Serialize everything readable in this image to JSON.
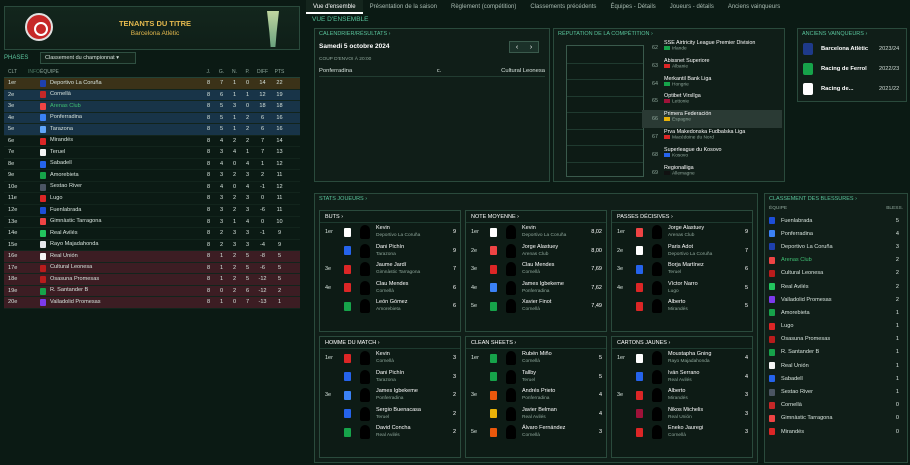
{
  "header": {
    "title": "TENANTS DU TITRE",
    "subtitle": "Barcelona Atlètic"
  },
  "phases": {
    "label": "PHASES",
    "selected": "Classement du championnat"
  },
  "league_table": {
    "columns": [
      "CLT",
      "INFO",
      "ÉQUIPE",
      "J.",
      "G.",
      "N.",
      "P.",
      "DIFF",
      "PTS"
    ],
    "rows": [
      {
        "pos": "1er",
        "club": "Deportivo La Coruña",
        "j": "8",
        "g": "7",
        "n": "1",
        "p": "0",
        "diff": "14",
        "pts": "22",
        "color": "#1e40af"
      },
      {
        "pos": "2e",
        "club": "Cornellà",
        "j": "8",
        "g": "6",
        "n": "1",
        "p": "1",
        "diff": "12",
        "pts": "19",
        "color": "#c62828"
      },
      {
        "pos": "3e",
        "club": "Arenas Club",
        "j": "8",
        "g": "5",
        "n": "3",
        "p": "0",
        "diff": "18",
        "pts": "18",
        "color": "#ef4444",
        "hl": true
      },
      {
        "pos": "4e",
        "club": "Ponferradina",
        "j": "8",
        "g": "5",
        "n": "1",
        "p": "2",
        "diff": "6",
        "pts": "16",
        "color": "#3b82f6"
      },
      {
        "pos": "5e",
        "club": "Tarazona",
        "j": "8",
        "g": "5",
        "n": "1",
        "p": "2",
        "diff": "6",
        "pts": "16",
        "color": "#60a5fa"
      },
      {
        "pos": "6e",
        "club": "Mirandés",
        "j": "8",
        "g": "4",
        "n": "2",
        "p": "2",
        "diff": "7",
        "pts": "14",
        "color": "#dc2626"
      },
      {
        "pos": "7e",
        "club": "Teruel",
        "j": "8",
        "g": "3",
        "n": "4",
        "p": "1",
        "diff": "7",
        "pts": "13",
        "color": "#f5f5f5"
      },
      {
        "pos": "8e",
        "club": "Sabadell",
        "j": "8",
        "g": "4",
        "n": "0",
        "p": "4",
        "diff": "1",
        "pts": "12",
        "color": "#2563eb"
      },
      {
        "pos": "9e",
        "club": "Amorebieta",
        "j": "8",
        "g": "3",
        "n": "2",
        "p": "3",
        "diff": "2",
        "pts": "11",
        "color": "#16a34a"
      },
      {
        "pos": "10e",
        "club": "Sestao River",
        "j": "8",
        "g": "4",
        "n": "0",
        "p": "4",
        "diff": "-1",
        "pts": "12",
        "color": "#4b5563"
      },
      {
        "pos": "11e",
        "club": "Lugo",
        "j": "8",
        "g": "3",
        "n": "2",
        "p": "3",
        "diff": "0",
        "pts": "11",
        "color": "#dc2626"
      },
      {
        "pos": "12e",
        "club": "Fuenlabrada",
        "j": "8",
        "g": "3",
        "n": "2",
        "p": "3",
        "diff": "-6",
        "pts": "11",
        "color": "#1d4ed8"
      },
      {
        "pos": "13e",
        "club": "Gimnàstic Tarragona",
        "j": "8",
        "g": "3",
        "n": "1",
        "p": "4",
        "diff": "0",
        "pts": "10",
        "color": "#ef4444"
      },
      {
        "pos": "14e",
        "club": "Real Avilés",
        "j": "8",
        "g": "2",
        "n": "3",
        "p": "3",
        "diff": "-1",
        "pts": "9",
        "color": "#22c55e"
      },
      {
        "pos": "15e",
        "club": "Rayo Majadahonda",
        "j": "8",
        "g": "2",
        "n": "3",
        "p": "3",
        "diff": "-4",
        "pts": "9",
        "color": "#e5e7eb"
      },
      {
        "pos": "16e",
        "club": "Real Unión",
        "j": "8",
        "g": "1",
        "n": "2",
        "p": "5",
        "diff": "-8",
        "pts": "5",
        "color": "#f5f5f5"
      },
      {
        "pos": "17e",
        "club": "Cultural Leonesa",
        "j": "8",
        "g": "1",
        "n": "2",
        "p": "5",
        "diff": "-6",
        "pts": "5",
        "color": "#b91c1c"
      },
      {
        "pos": "18e",
        "club": "Osasuna Promesas",
        "j": "8",
        "g": "1",
        "n": "2",
        "p": "5",
        "diff": "-12",
        "pts": "5",
        "color": "#b91c1c"
      },
      {
        "pos": "19e",
        "club": "R. Santander B",
        "j": "8",
        "g": "0",
        "n": "2",
        "p": "6",
        "diff": "-12",
        "pts": "2",
        "color": "#16a34a"
      },
      {
        "pos": "20e",
        "club": "Valladolid Promesas",
        "j": "8",
        "g": "1",
        "n": "0",
        "p": "7",
        "diff": "-13",
        "pts": "1",
        "color": "#7c3aed"
      }
    ]
  },
  "tabs": [
    "Vue d'ensemble",
    "Présentation de la saison",
    "Règlement (compétition)",
    "Classements précédents",
    "Équipes - Détails",
    "Joueurs - détails",
    "Anciens vainqueurs"
  ],
  "overview_label": "VUE D'ENSEMBLE",
  "calendar": {
    "title": "CALENDRIER/RÉSULTATS",
    "date": "Samedi 5 octobre 2024",
    "prev": "‹",
    "next": "›",
    "kickoff": "COUP D'ENVOI À 20:00",
    "home": "Ponferradina",
    "mid": "c.",
    "away": "Cultural Leonesa"
  },
  "reputation": {
    "title": "RÉPUTATION DE LA COMPÉTITION",
    "rows": [
      {
        "n": "62",
        "league": "SSE Airtricity League Premier Division",
        "country": "Irlande",
        "flag": "#16a34a"
      },
      {
        "n": "63",
        "league": "Abissnet Superiore",
        "country": "Albanie",
        "flag": "#dc2626"
      },
      {
        "n": "64",
        "league": "Merkantil Bank Liga",
        "country": "Hongrie",
        "flag": "#16a34a"
      },
      {
        "n": "65",
        "league": "Optibet Virslīga",
        "country": "Lettonie",
        "flag": "#9f1239"
      },
      {
        "n": "66",
        "league": "Primera Federación",
        "country": "Espagne",
        "flag": "#eab308",
        "sel": true
      },
      {
        "n": "67",
        "league": "Prva Makedonska Fudbalska Liga",
        "country": "Macédoine du Nord",
        "flag": "#dc2626"
      },
      {
        "n": "68",
        "league": "Superleague du Kosovo",
        "country": "Kosovo",
        "flag": "#2563eb"
      },
      {
        "n": "69",
        "league": "Regionalliga",
        "country": "Allemagne",
        "flag": "#111111"
      }
    ]
  },
  "winners": {
    "title": "ANCIENS VAINQUEURS",
    "rows": [
      {
        "club": "Barcelona Atlètic",
        "year": "2023/24",
        "color": "#1e3a8a"
      },
      {
        "club": "Racing de Ferrol",
        "year": "2022/23",
        "color": "#16a34a"
      },
      {
        "club": "Racing de...",
        "year": "2021/22",
        "color": "#ffffff"
      }
    ]
  },
  "stats": {
    "title": "STATS JOUEURS",
    "boxes": [
      {
        "title": "BUTS",
        "rows": [
          {
            "rk": "1er",
            "player": "Kevin",
            "club": "Deportivo La Coruña",
            "val": "9",
            "shirt": "#ffffff"
          },
          {
            "rk": "",
            "player": "Dani Pichín",
            "club": "Tarazona",
            "val": "9",
            "shirt": "#2563eb"
          },
          {
            "rk": "3e",
            "player": "Jaume Jardí",
            "club": "Gimnàstic Tarragona",
            "val": "7",
            "shirt": "#dc2626"
          },
          {
            "rk": "4e",
            "player": "Clau Mendes",
            "club": "Cornellà",
            "val": "6",
            "shirt": "#dc2626"
          },
          {
            "rk": "",
            "player": "León Gómez",
            "club": "Amorebieta",
            "val": "6",
            "shirt": "#16a34a"
          }
        ]
      },
      {
        "title": "NOTE MOYENNE",
        "rows": [
          {
            "rk": "1er",
            "player": "Kevin",
            "club": "Deportivo La Coruña",
            "val": "8,02",
            "shirt": "#ffffff"
          },
          {
            "rk": "2e",
            "player": "Jorge Alastuey",
            "club": "Arenas Club",
            "val": "8,00",
            "shirt": "#ef4444"
          },
          {
            "rk": "3e",
            "player": "Clau Mendes",
            "club": "Cornellà",
            "val": "7,69",
            "shirt": "#dc2626"
          },
          {
            "rk": "4e",
            "player": "James Igbekeme",
            "club": "Ponferradina",
            "val": "7,62",
            "shirt": "#3b82f6"
          },
          {
            "rk": "5e",
            "player": "Xavier Finot",
            "club": "Cornellà",
            "val": "7,49",
            "shirt": "#16a34a"
          }
        ]
      },
      {
        "title": "PASSES DÉCISIVES",
        "rows": [
          {
            "rk": "1er",
            "player": "Jorge Alastuey",
            "club": "Arenas Club",
            "val": "9",
            "shirt": "#ef4444"
          },
          {
            "rk": "2e",
            "player": "Paris Adot",
            "club": "Deportivo La Coruña",
            "val": "7",
            "shirt": "#ffffff"
          },
          {
            "rk": "3e",
            "player": "Borja Martínez",
            "club": "Teruel",
            "val": "6",
            "shirt": "#2563eb"
          },
          {
            "rk": "4e",
            "player": "Víctor Narro",
            "club": "Lugo",
            "val": "5",
            "shirt": "#dc2626"
          },
          {
            "rk": "",
            "player": "Alberto",
            "club": "Mirandés",
            "val": "5",
            "shirt": "#dc2626"
          }
        ]
      },
      {
        "title": "HOMME DU MATCH",
        "rows": [
          {
            "rk": "1er",
            "player": "Kevin",
            "club": "Cornellà",
            "val": "3",
            "shirt": "#dc2626"
          },
          {
            "rk": "",
            "player": "Dani Pichín",
            "club": "Tarazona",
            "val": "3",
            "shirt": "#2563eb"
          },
          {
            "rk": "3e",
            "player": "James Igbekeme",
            "club": "Ponferradina",
            "val": "2",
            "shirt": "#3b82f6"
          },
          {
            "rk": "",
            "player": "Sergio Buenacasa",
            "club": "Teruel",
            "val": "2",
            "shirt": "#2563eb"
          },
          {
            "rk": "",
            "player": "David Concha",
            "club": "Real Avilés",
            "val": "2",
            "shirt": "#16a34a"
          }
        ]
      },
      {
        "title": "CLEAN SHEETS",
        "rows": [
          {
            "rk": "1er",
            "player": "Rubén Miño",
            "club": "Cornellà",
            "val": "5",
            "shirt": "#16a34a"
          },
          {
            "rk": "",
            "player": "Tallby",
            "club": "Teruel",
            "val": "5",
            "shirt": "#16a34a"
          },
          {
            "rk": "3e",
            "player": "Andrés Prieto",
            "club": "Ponferradina",
            "val": "4",
            "shirt": "#ea580c"
          },
          {
            "rk": "",
            "player": "Javier Belman",
            "club": "Real Avilés",
            "val": "4",
            "shirt": "#eab308"
          },
          {
            "rk": "5e",
            "player": "Álvaro Fernández",
            "club": "Cornellà",
            "val": "3",
            "shirt": "#ea580c"
          }
        ]
      },
      {
        "title": "CARTONS JAUNES",
        "rows": [
          {
            "rk": "1er",
            "player": "Moustapha Gning",
            "club": "Rayo Majadahonda",
            "val": "4",
            "shirt": "#ffffff"
          },
          {
            "rk": "",
            "player": "Iván Serrano",
            "club": "Real Avilés",
            "val": "4",
            "shirt": "#2563eb"
          },
          {
            "rk": "3e",
            "player": "Alberto",
            "club": "Mirandés",
            "val": "3",
            "shirt": "#dc2626"
          },
          {
            "rk": "",
            "player": "Nikos Michelis",
            "club": "Real Unión",
            "val": "3",
            "shirt": "#9f1239"
          },
          {
            "rk": "",
            "player": "Eneko Jauregi",
            "club": "Cornellà",
            "val": "3",
            "shirt": "#dc2626"
          }
        ]
      }
    ]
  },
  "injuries": {
    "title": "CLASSEMENT DES BLESSURES",
    "col_team": "ÉQUIPE",
    "col_val": "BLESS.",
    "rows": [
      {
        "club": "Fuenlabrada",
        "val": "5",
        "color": "#1d4ed8"
      },
      {
        "club": "Ponferradina",
        "val": "4",
        "color": "#3b82f6"
      },
      {
        "club": "Deportivo La Coruña",
        "val": "3",
        "color": "#1e40af"
      },
      {
        "club": "Arenas Club",
        "val": "2",
        "color": "#ef4444",
        "hl": true
      },
      {
        "club": "Cultural Leonesa",
        "val": "2",
        "color": "#b91c1c"
      },
      {
        "club": "Real Avilés",
        "val": "2",
        "color": "#22c55e"
      },
      {
        "club": "Valladolid Promesas",
        "val": "2",
        "color": "#7c3aed"
      },
      {
        "club": "Amorebieta",
        "val": "1",
        "color": "#16a34a"
      },
      {
        "club": "Lugo",
        "val": "1",
        "color": "#dc2626"
      },
      {
        "club": "Osasuna Promesas",
        "val": "1",
        "color": "#b91c1c"
      },
      {
        "club": "R. Santander B",
        "val": "1",
        "color": "#16a34a"
      },
      {
        "club": "Real Unión",
        "val": "1",
        "color": "#f5f5f5"
      },
      {
        "club": "Sabadell",
        "val": "1",
        "color": "#2563eb"
      },
      {
        "club": "Sestao River",
        "val": "1",
        "color": "#4b5563"
      },
      {
        "club": "Cornellà",
        "val": "0",
        "color": "#c62828"
      },
      {
        "club": "Gimnàstic Tarragona",
        "val": "0",
        "color": "#ef4444"
      },
      {
        "club": "Mirandés",
        "val": "0",
        "color": "#dc2626"
      }
    ]
  }
}
